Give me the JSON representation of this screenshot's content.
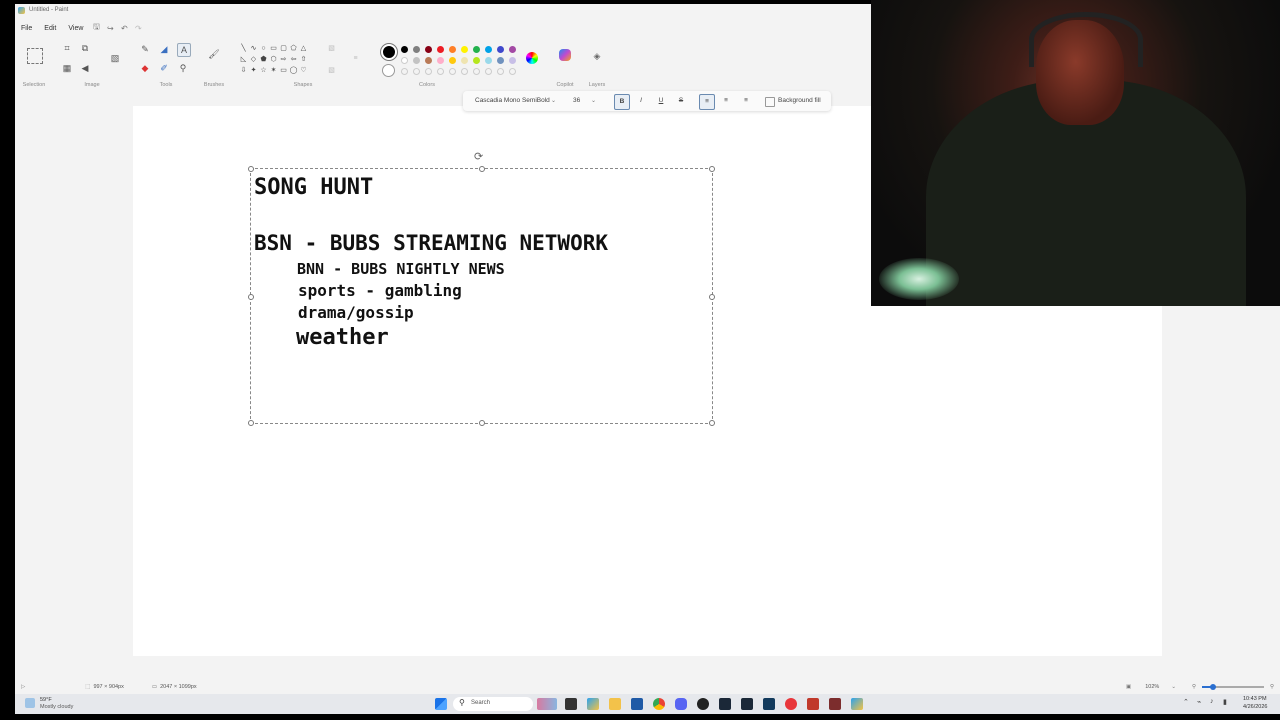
{
  "window": {
    "title": "Untitled - Paint"
  },
  "menu": {
    "file": "File",
    "edit": "Edit",
    "view": "View"
  },
  "ribbon": {
    "groups": {
      "selection": "Selection",
      "image": "Image",
      "tools": "Tools",
      "brushes": "Brushes",
      "shapes": "Shapes",
      "colors": "Colors",
      "copilot": "Copilot",
      "layers": "Layers"
    },
    "palette_row1": [
      "#000000",
      "#7f7f7f",
      "#880015",
      "#ed1c24",
      "#ff7f27",
      "#fff200",
      "#22b14c",
      "#00a2e8",
      "#3f48cc",
      "#a349a4"
    ],
    "palette_row2": [
      "#ffffff",
      "#c3c3c3",
      "#b97a57",
      "#ffaec9",
      "#ffc90e",
      "#efe4b0",
      "#b5e61d",
      "#99d9ea",
      "#7092be",
      "#c8bfe7"
    ],
    "primary_color": "#000000"
  },
  "font_toolbar": {
    "font_family": "Cascadia Mono SemiBold",
    "font_size": "36",
    "bold": "B",
    "italic": "I",
    "underline": "U",
    "strikethrough": "S",
    "background_fill": "Background fill"
  },
  "canvas_text": {
    "line1": "SONG HUNT",
    "line2": "BSN - BUBS STREAMING NETWORK",
    "line3": "BNN - BUBS NIGHTLY NEWS",
    "line4": "sports - gambling",
    "line5": "drama/gossip",
    "line6": "weather"
  },
  "status": {
    "cursor": "997 × 904px",
    "canvas_size": "2047 × 1099px",
    "zoom": "102%"
  },
  "taskbar": {
    "weather_temp": "59°F",
    "weather_desc": "Mostly cloudy",
    "search": "Search",
    "time": "10:43 PM",
    "date": "4/26/2026"
  }
}
